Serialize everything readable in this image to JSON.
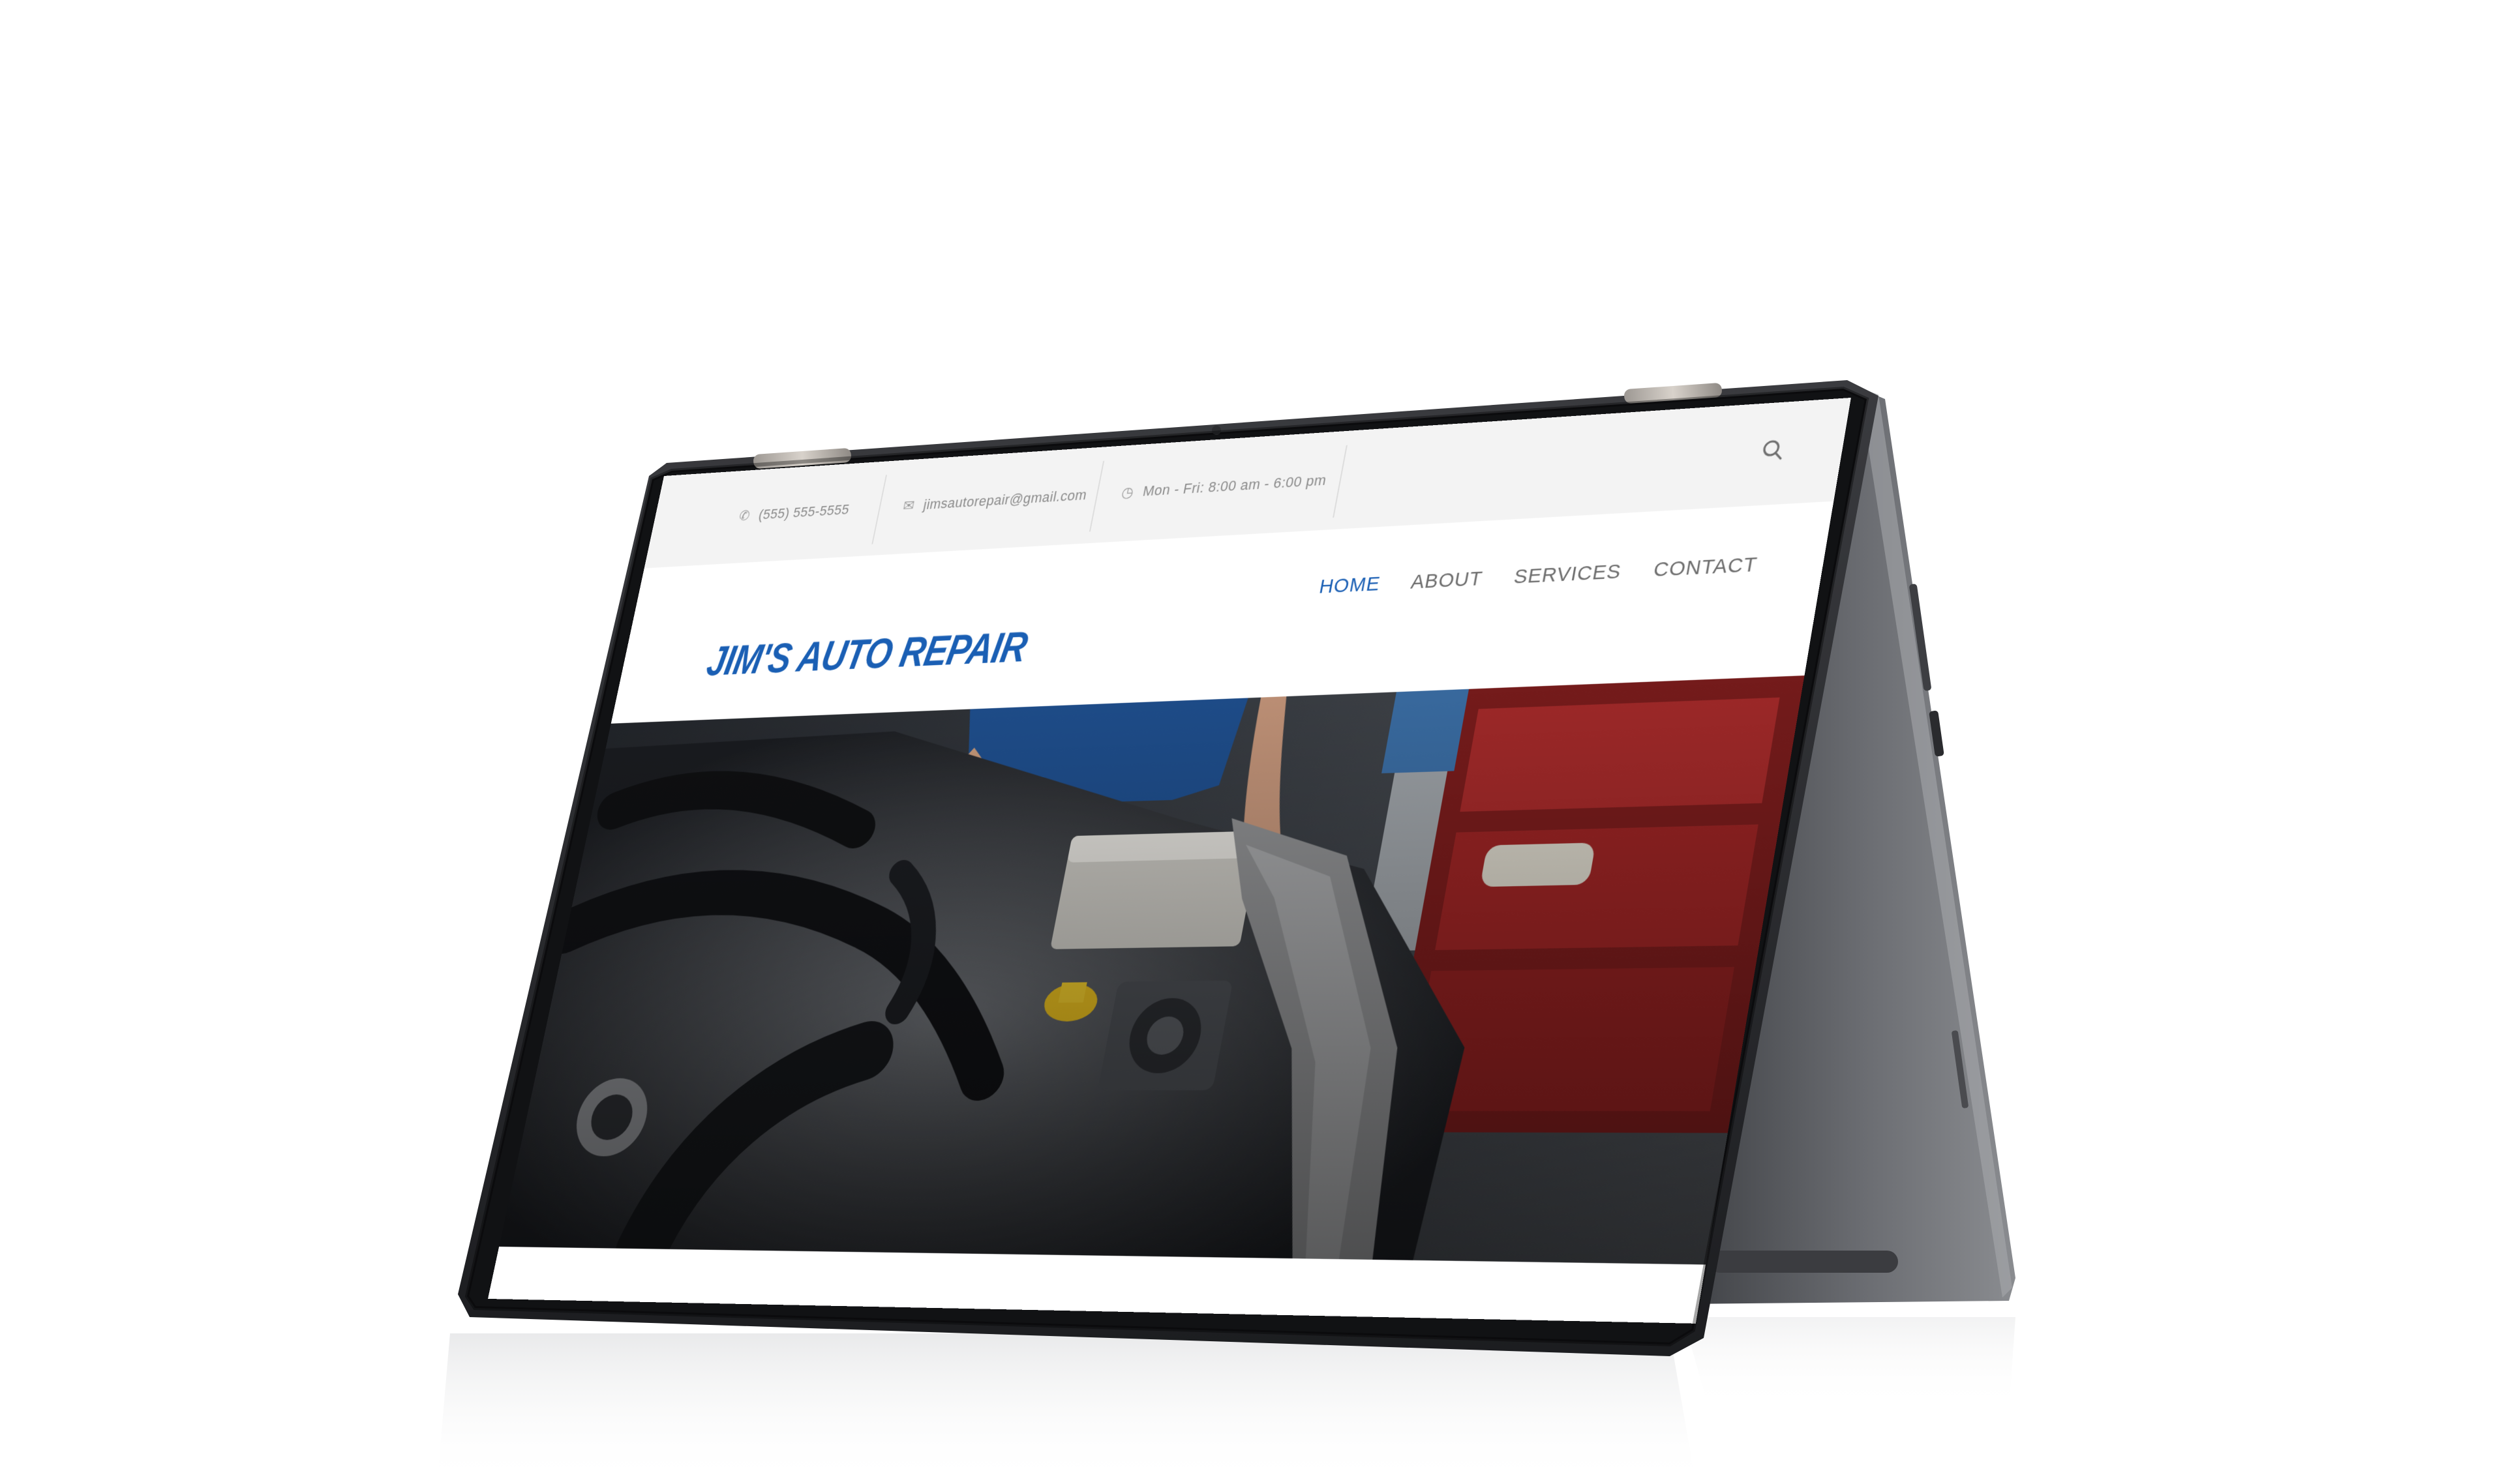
{
  "site": {
    "topbar": {
      "phone": "(555) 555-5555",
      "email": "jimsautorepair@gmail.com",
      "hours": "Mon - Fri: 8:00 am - 6:00 pm",
      "search_icon": "search-icon"
    },
    "logo": "JIM'S AUTO REPAIR",
    "nav": [
      "HOME",
      "ABOUT",
      "SERVICES",
      "CONTACT"
    ],
    "active_nav": "HOME",
    "hero_image": "mechanic working on car engine"
  },
  "colors": {
    "brand_blue": "#1a5fb4",
    "topbar_bg": "#f3f3f3",
    "device_frame": "#2b2c2f",
    "device_body": "#5a5c60"
  }
}
